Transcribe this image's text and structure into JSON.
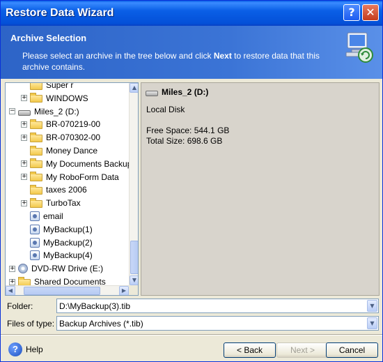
{
  "window": {
    "title": "Restore Data Wizard",
    "help_glyph": "?",
    "close_glyph": "✕"
  },
  "header": {
    "title": "Archive Selection",
    "desc_pre": "Please select an archive in the tree below and click ",
    "desc_bold": "Next",
    "desc_post": " to restore data that this archive contains."
  },
  "tree": {
    "items": [
      {
        "label": "Super r",
        "icon": "folder-icon",
        "indent": 1,
        "expander": ""
      },
      {
        "label": "WINDOWS",
        "icon": "folder-icon",
        "indent": 1,
        "expander": "+"
      },
      {
        "label": "Miles_2 (D:)",
        "icon": "drive-icon",
        "indent": 0,
        "expander": "−"
      },
      {
        "label": "BR-070219-00",
        "icon": "folder-icon",
        "indent": 1,
        "expander": "+"
      },
      {
        "label": "BR-070302-00",
        "icon": "folder-icon",
        "indent": 1,
        "expander": "+"
      },
      {
        "label": "Money Dance",
        "icon": "folder-icon",
        "indent": 1,
        "expander": ""
      },
      {
        "label": "My Documents Backup",
        "icon": "folder-icon",
        "indent": 1,
        "expander": "+"
      },
      {
        "label": "My RoboForm Data",
        "icon": "folder-icon",
        "indent": 1,
        "expander": "+"
      },
      {
        "label": "taxes 2006",
        "icon": "folder-icon",
        "indent": 1,
        "expander": ""
      },
      {
        "label": "TurboTax",
        "icon": "folder-icon",
        "indent": 1,
        "expander": "+"
      },
      {
        "label": "email",
        "icon": "backup-archive-icon",
        "indent": 1,
        "expander": ""
      },
      {
        "label": "MyBackup(1)",
        "icon": "backup-archive-icon",
        "indent": 1,
        "expander": ""
      },
      {
        "label": "MyBackup(2)",
        "icon": "backup-archive-icon",
        "indent": 1,
        "expander": ""
      },
      {
        "label": "MyBackup(4)",
        "icon": "backup-archive-icon",
        "indent": 1,
        "expander": ""
      },
      {
        "label": "DVD-RW Drive (E:)",
        "icon": "dvd-drive-icon",
        "indent": 0,
        "expander": "+"
      },
      {
        "label": "Shared Documents",
        "icon": "folder-icon",
        "indent": 0,
        "expander": "+"
      }
    ]
  },
  "info": {
    "name": "Miles_2 (D:)",
    "type": "Local Disk",
    "free_space": "Free Space: 544.1 GB",
    "total_size": "Total Size: 698.6 GB"
  },
  "fields": {
    "folder_label": "Folder:",
    "folder_value": "D:\\MyBackup(3).tib",
    "filetype_label": "Files of type:",
    "filetype_value": "Backup Archives (*.tib)"
  },
  "footer": {
    "help_label": "Help",
    "back_label": "< Back",
    "next_label": "Next >",
    "cancel_label": "Cancel"
  }
}
